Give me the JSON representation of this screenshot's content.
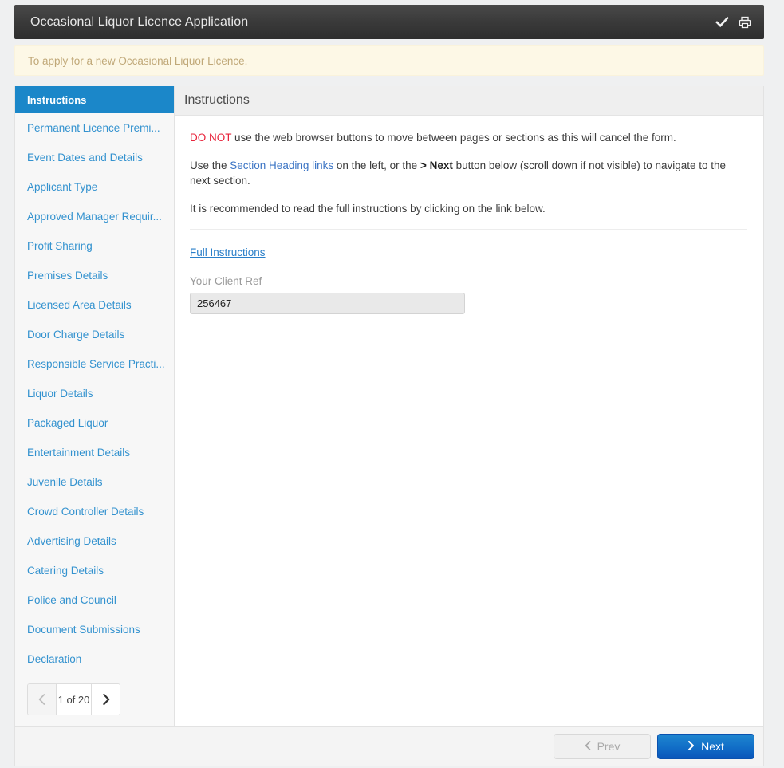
{
  "titlebar": {
    "title": "Occasional Liquor Licence Application",
    "save_icon": "check-icon",
    "print_icon": "printer-icon"
  },
  "notice": {
    "message": "To apply for a new Occasional Liquor Licence."
  },
  "sidebar": {
    "items": [
      {
        "label": "Instructions",
        "active": true
      },
      {
        "label": "Permanent Licence Premi...",
        "active": false
      },
      {
        "label": "Event Dates and Details",
        "active": false
      },
      {
        "label": "Applicant Type",
        "active": false
      },
      {
        "label": "Approved Manager Requir...",
        "active": false
      },
      {
        "label": "Profit Sharing",
        "active": false
      },
      {
        "label": "Premises Details",
        "active": false
      },
      {
        "label": "Licensed Area Details",
        "active": false
      },
      {
        "label": "Door Charge Details",
        "active": false
      },
      {
        "label": "Responsible Service Practi...",
        "active": false
      },
      {
        "label": "Liquor Details",
        "active": false
      },
      {
        "label": "Packaged Liquor",
        "active": false
      },
      {
        "label": "Entertainment Details",
        "active": false
      },
      {
        "label": "Juvenile Details",
        "active": false
      },
      {
        "label": "Crowd Controller Details",
        "active": false
      },
      {
        "label": "Advertising Details",
        "active": false
      },
      {
        "label": "Catering Details",
        "active": false
      },
      {
        "label": "Police and Council",
        "active": false
      },
      {
        "label": "Document Submissions",
        "active": false
      },
      {
        "label": "Declaration",
        "active": false
      }
    ],
    "pager": {
      "prev_icon": "chevron-left-icon",
      "label": "1 of 20",
      "next_icon": "chevron-right-icon",
      "current_page": 1,
      "total_pages": 20
    }
  },
  "content": {
    "header": "Instructions",
    "paragraph1": {
      "emphasis": "DO NOT",
      "rest": " use the web browser buttons to move between pages or sections as this will cancel the form."
    },
    "paragraph2": {
      "part1": "Use the ",
      "link": "Section Heading links",
      "part2": " on the left, or the ",
      "bold": "> Next",
      "part3": " button below (scroll down if not visible) to navigate to the next section."
    },
    "paragraph3": "It is recommended to read the full instructions by clicking on the link below.",
    "full_instructions_link": "Full Instructions",
    "client_ref": {
      "label": "Your Client Ref",
      "value": "256467",
      "placeholder": ""
    }
  },
  "footer": {
    "prev_label": "Prev",
    "prev_icon": "chevron-left-icon",
    "next_label": "Next",
    "next_icon": "chevron-right-icon"
  },
  "colors": {
    "accent_blue": "#1b87c9",
    "link_blue": "#3392cf",
    "danger_red": "#e8243c",
    "notice_bg": "#fdf8e6",
    "notice_text": "#c0a878",
    "titlebar_dark": "#3b3b3b"
  }
}
